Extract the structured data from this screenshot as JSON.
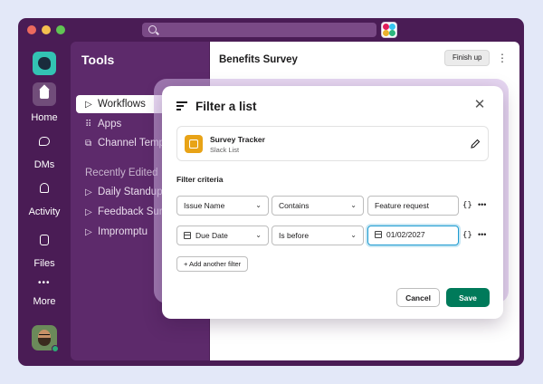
{
  "titlebar": {
    "search_icon": "search-icon",
    "app_badge_icon": "app-badge-icon"
  },
  "rail": {
    "items": [
      {
        "label": "Home",
        "icon": "home-icon",
        "active": true
      },
      {
        "label": "DMs",
        "icon": "dm-icon"
      },
      {
        "label": "Activity",
        "icon": "bell-icon"
      },
      {
        "label": "Files",
        "icon": "files-icon"
      },
      {
        "label": "More",
        "icon": "more-icon"
      }
    ]
  },
  "sidebar": {
    "title": "Tools",
    "items": [
      {
        "label": "Workflows",
        "icon": "play-icon",
        "active": true
      },
      {
        "label": "Apps",
        "icon": "grid-icon"
      },
      {
        "label": "Channel Templates",
        "icon": "copy-icon"
      }
    ],
    "section_title": "Recently Edited",
    "recent": [
      {
        "label": "Daily Standup",
        "icon": "play-icon"
      },
      {
        "label": "Feedback Survey",
        "icon": "play-icon"
      },
      {
        "label": "Impromptu",
        "icon": "play-icon"
      }
    ]
  },
  "main": {
    "title": "Benefits Survey",
    "finish_label": "Finish up"
  },
  "dialog": {
    "title": "Filter a list",
    "list": {
      "name": "Survey Tracker",
      "type": "Slack List"
    },
    "criteria_label": "Filter criteria",
    "filters": [
      {
        "field": "Issue Name",
        "operator": "Contains",
        "value": "Feature request"
      },
      {
        "field": "Due Date",
        "operator": "Is before",
        "value": "01/02/2027"
      }
    ],
    "add_filter_label": "+ Add another filter",
    "cancel_label": "Cancel",
    "save_label": "Save"
  },
  "colors": {
    "aubergine": "#4a1c55",
    "sidebar": "#5d2a6b",
    "save_green": "#007a5a",
    "focus_blue": "#1d9bd1"
  }
}
